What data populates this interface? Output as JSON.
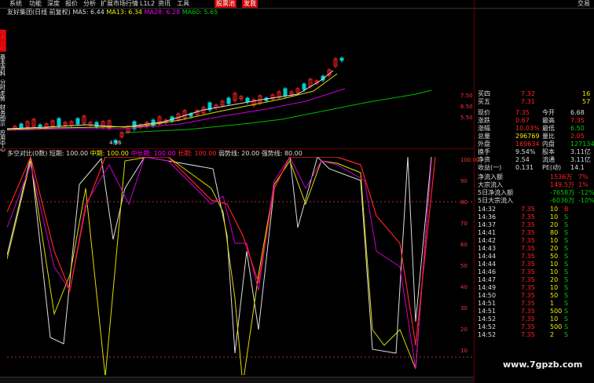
{
  "menu": {
    "items": [
      "系统",
      "功能",
      "深度",
      "报价",
      "分析",
      "扩展市场行情",
      "L1L2",
      "资讯",
      "工具"
    ],
    "highlight": [
      "股票池",
      "发我"
    ],
    "corner": "交易"
  },
  "side_tabs": [
    "技术分析",
    "基本资料",
    "分时走势",
    "财务图示",
    "应用中心"
  ],
  "chart_title": {
    "stock": "友好集团(日线 前复权)",
    "ma5": "MA5: 6.44",
    "ma13": "MA13: 6.34",
    "ma28": "MA28: 6.28",
    "ma60": "MA60: 5.65"
  },
  "low_label": "4.36",
  "indicator_line": {
    "name": "多空对比(0数)",
    "short": "短期: 100.00",
    "mid": "中期: 100.00",
    "midlong": "中长期: 100.00",
    "long": "长期: 100.00",
    "weak": "弱势线: 20.00",
    "strong": "强势线: 80.00"
  },
  "axis_labels": [
    "100.00",
    "90",
    "80",
    "70",
    "60",
    "50",
    "40",
    "30",
    "20",
    "10"
  ],
  "right_axis_price": [
    "7.50",
    "6.50",
    "5.50"
  ],
  "panel": {
    "bids": [
      {
        "label": "买四",
        "price": "7.32",
        "vol": "16"
      },
      {
        "label": "买五",
        "price": "7.31",
        "vol": "57"
      }
    ],
    "stats": [
      {
        "l1": "现价",
        "v1": "7.35",
        "l2": "今开",
        "v2": "6.68"
      },
      {
        "l1": "涨跌",
        "v1": "0.67",
        "l2": "最高",
        "v2": "7.35"
      },
      {
        "l1": "涨幅",
        "v1": "10.03%",
        "l2": "最低",
        "v2": "6.50"
      },
      {
        "l1": "总量",
        "v1": "296769",
        "l2": "量比",
        "v2": "2.05"
      },
      {
        "l1": "外盘",
        "v1": "169634",
        "l2": "内盘",
        "v2": "127134"
      },
      {
        "l1": "换手",
        "v1": "9.54%",
        "l2": "股本",
        "v2": "3.11亿"
      },
      {
        "l1": "净资",
        "v1": "2.54",
        "l2": "流通",
        "v2": "3.11亿"
      },
      {
        "l1": "收益(一)",
        "v1": "0.131",
        "l2": "PE(动)",
        "v2": "14.1"
      }
    ],
    "flows": [
      {
        "label": "净流入额",
        "value": "1536万",
        "pct": "7%"
      },
      {
        "label": "大宗流入",
        "value": "149.5万",
        "pct": "1%"
      },
      {
        "label": "5日净流入额",
        "value": "-7658万",
        "pct": "-12%"
      },
      {
        "label": "5日大宗流入",
        "value": "-6036万",
        "pct": "-10%"
      }
    ],
    "ticks": [
      {
        "t": "14:32",
        "p": "7.35",
        "v": "10",
        "d": "B"
      },
      {
        "t": "14:36",
        "p": "7.35",
        "v": "10",
        "d": "S"
      },
      {
        "t": "14:37",
        "p": "7.35",
        "v": "20",
        "d": "S"
      },
      {
        "t": "14:41",
        "p": "7.35",
        "v": "80",
        "d": "S"
      },
      {
        "t": "14:42",
        "p": "7.35",
        "v": "10",
        "d": "S"
      },
      {
        "t": "14:43",
        "p": "7.35",
        "v": "20",
        "d": "S"
      },
      {
        "t": "14:44",
        "p": "7.35",
        "v": "50",
        "d": "S"
      },
      {
        "t": "14:44",
        "p": "7.35",
        "v": "10",
        "d": "S"
      },
      {
        "t": "14:46",
        "p": "7.35",
        "v": "10",
        "d": "S"
      },
      {
        "t": "14:47",
        "p": "7.35",
        "v": "20",
        "d": "S"
      },
      {
        "t": "14:49",
        "p": "7.35",
        "v": "10",
        "d": "S"
      },
      {
        "t": "14:50",
        "p": "7.35",
        "v": "50",
        "d": "S"
      },
      {
        "t": "14:51",
        "p": "7.35",
        "v": "1",
        "d": "S"
      },
      {
        "t": "14:51",
        "p": "7.35",
        "v": "500",
        "d": "S"
      },
      {
        "t": "14:52",
        "p": "7.35",
        "v": "10",
        "d": "S"
      },
      {
        "t": "14:52",
        "p": "7.35",
        "v": "500",
        "d": "S"
      },
      {
        "t": "14:52",
        "p": "7.35",
        "v": "2",
        "d": "S"
      }
    ]
  },
  "watermark": "www.7gpzb.com",
  "colors": {
    "up": "#ff2222",
    "down": "#00cccc",
    "bg": "#000000"
  }
}
